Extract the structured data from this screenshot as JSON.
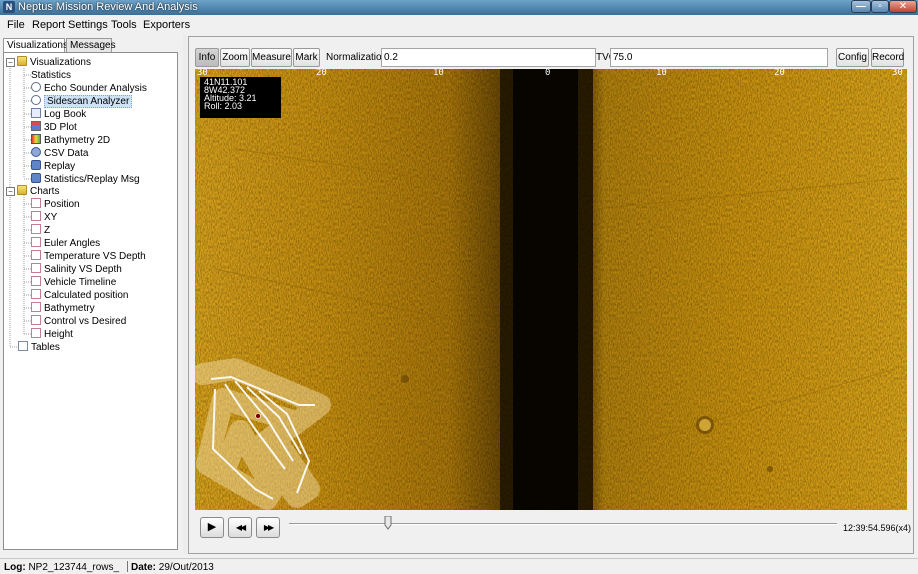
{
  "window": {
    "title": "Neptus Mission Review And Analysis",
    "app_icon_glyph": "N",
    "minimize_glyph": "—",
    "maximize_glyph": "▫",
    "close_glyph": "✕"
  },
  "menu": [
    "File",
    "Report",
    "Settings",
    "Tools",
    "Exporters"
  ],
  "left_tabs": [
    "Visualizations",
    "Messages"
  ],
  "tree": {
    "root": "Visualizations",
    "statistics": "Statistics",
    "viz_items": [
      {
        "label": "Echo Sounder Analysis",
        "icon": "clock-icon"
      },
      {
        "label": "Sidescan Analyzer",
        "icon": "clock-icon",
        "selected": true
      },
      {
        "label": "Log Book",
        "icon": "book-icon"
      },
      {
        "label": "3D Plot",
        "icon": "plot3d-icon"
      },
      {
        "label": "Bathymetry 2D",
        "icon": "bathymetry-icon"
      },
      {
        "label": "CSV Data",
        "icon": "csv-icon"
      },
      {
        "label": "Replay",
        "icon": "replay-icon"
      },
      {
        "label": "Statistics/Replay Msg",
        "icon": "replay-icon"
      }
    ],
    "charts_label": "Charts",
    "chart_items": [
      "Position",
      "XY",
      "Z",
      "Euler Angles",
      "Temperature VS Depth",
      "Salinity VS Depth",
      "Vehicle Timeline",
      "Calculated position",
      "Bathymetry",
      "Control vs Desired",
      "Height"
    ],
    "tables_label": "Tables"
  },
  "toolbar": {
    "info": "Info",
    "zoom": "Zoom",
    "measure": "Measure",
    "mark": "Mark",
    "normalization_label": "Normalization",
    "normalization_value": "0.2",
    "tvg_label": "TVG",
    "tvg_value": "75.0",
    "config": "Config",
    "record": "Record"
  },
  "ruler_labels": [
    "30",
    "20",
    "10",
    "0",
    "10",
    "20",
    "30"
  ],
  "info_box": {
    "lat": "41N11.101",
    "lon": "8W42.372",
    "altitude": "Altitude: 3.21",
    "roll": "Roll: 2.03"
  },
  "player": {
    "play_glyph": "▶",
    "rewind_glyph": "◀◀",
    "forward_glyph": "▶▶",
    "time": "12:39:54.596(x4)",
    "position_fraction": 0.18
  },
  "status": {
    "log_label": "Log:",
    "log_value": "NP2_123744_rows_",
    "date_label": "Date:",
    "date_value": "29/Out/2013"
  },
  "colors": {
    "sonar_gold": "#c6910f",
    "sonar_dark": "#1a1200",
    "selection": "#cfe3f7"
  }
}
